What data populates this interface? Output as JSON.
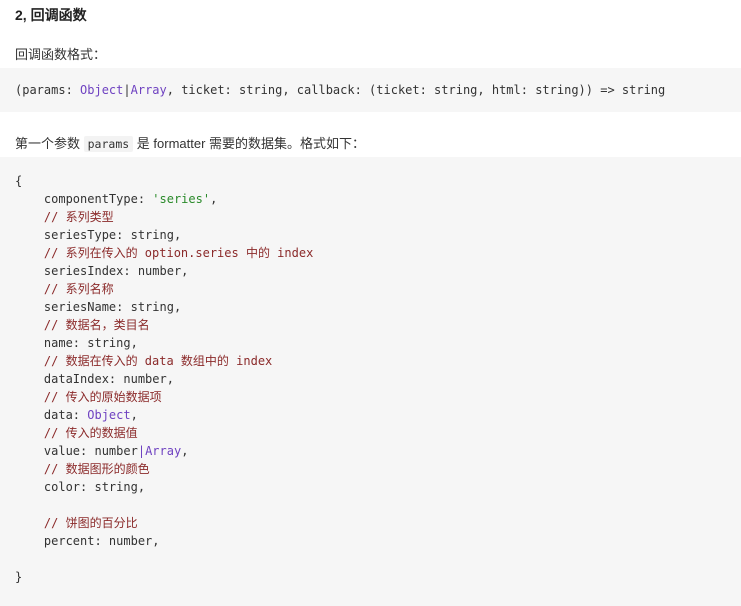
{
  "heading": "2, 回调函数",
  "p1": "回调函数格式：",
  "signature": {
    "a": "(params: ",
    "b": "Object",
    "c": "|",
    "d": "Array",
    "e": ", ticket: string, callback: (ticket: string, html: string)) => string"
  },
  "p2": {
    "before": "第一个参数 ",
    "code": "params",
    "after": " 是 formatter 需要的数据集。格式如下："
  },
  "code": {
    "open": "{",
    "l1a": "    componentType: ",
    "l1b": "'series'",
    "l1c": ",",
    "c1": "    // 系列类型",
    "l2": "    seriesType: string,",
    "c2": "    // 系列在传入的 option.series 中的 index",
    "l3": "    seriesIndex: number,",
    "c3": "    // 系列名称",
    "l4": "    seriesName: string,",
    "c4": "    // 数据名，类目名",
    "l5": "    name: string,",
    "c5": "    // 数据在传入的 data 数组中的 index",
    "l6": "    dataIndex: number,",
    "c6": "    // 传入的原始数据项",
    "l7a": "    data: ",
    "l7b": "Object",
    "l7c": ",",
    "c7": "    // 传入的数据值",
    "l8a": "    value: number",
    "l8b": "|",
    "l8c": "Array",
    "l8d": ",",
    "c8": "    // 数据图形的颜色",
    "l9": "    color: string,",
    "c9": "    // 饼图的百分比",
    "l10": "    percent: number,",
    "close": "}"
  }
}
